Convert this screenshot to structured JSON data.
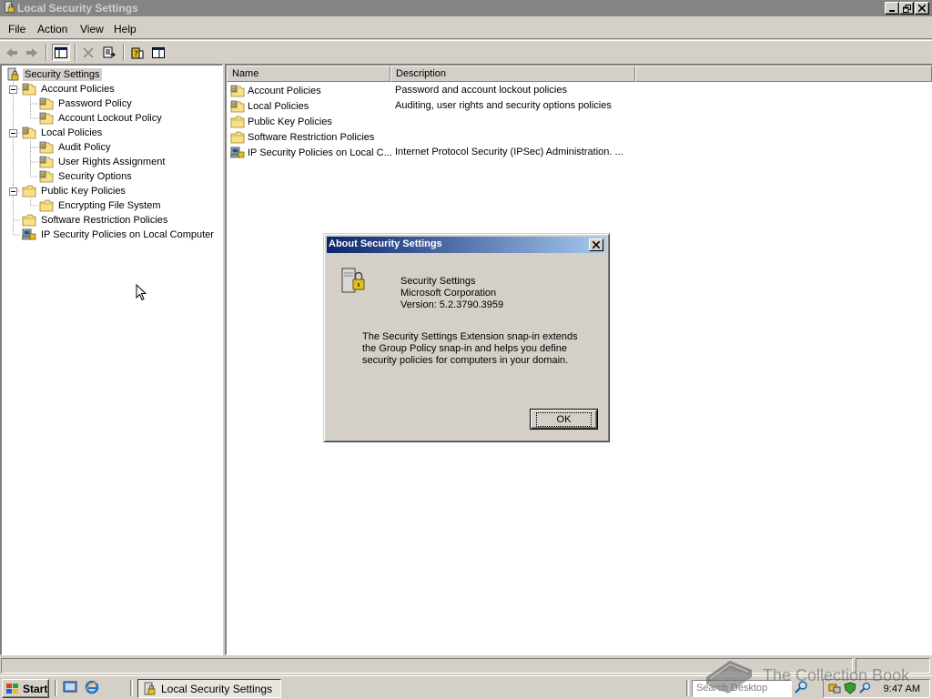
{
  "window": {
    "title": "Local Security Settings"
  },
  "menu": {
    "file": "File",
    "action": "Action",
    "view": "View",
    "help": "Help"
  },
  "tree": {
    "root": "Security Settings",
    "account_policies": "Account Policies",
    "password_policy": "Password Policy",
    "account_lockout_policy": "Account Lockout Policy",
    "local_policies": "Local Policies",
    "audit_policy": "Audit Policy",
    "user_rights_assignment": "User Rights Assignment",
    "security_options": "Security Options",
    "public_key_policies": "Public Key Policies",
    "encrypting_file_system": "Encrypting File System",
    "software_restriction_policies": "Software Restriction Policies",
    "ip_security_policies": "IP Security Policies on Local Computer"
  },
  "list": {
    "columns": {
      "name": "Name",
      "description": "Description"
    },
    "rows": [
      {
        "name": "Account Policies",
        "description": "Password and account lockout policies"
      },
      {
        "name": "Local Policies",
        "description": "Auditing, user rights and security options policies"
      },
      {
        "name": "Public Key Policies",
        "description": ""
      },
      {
        "name": "Software Restriction Policies",
        "description": ""
      },
      {
        "name": "IP Security Policies on Local C...",
        "description": "Internet Protocol Security (IPSec) Administration. ..."
      }
    ]
  },
  "dialog": {
    "title": "About Security Settings",
    "product": "Security Settings",
    "company": "Microsoft Corporation",
    "version": "Version: 5.2.3790.3959",
    "description_line1": "The Security Settings Extension snap-in extends",
    "description_line2": "the Group Policy snap-in and helps you define",
    "description_line3": "security policies for computers in your domain.",
    "ok_label": "OK"
  },
  "taskbar": {
    "start_label": "Start",
    "task_label": "Local Security Settings",
    "search_placeholder": "Search Desktop",
    "clock": "9:47 AM"
  },
  "watermark": {
    "text": "The Collection Book"
  },
  "colors": {
    "inactive_titlebar": "#848484",
    "dialog_title_start": "#0a246a",
    "dialog_title_end": "#a6caf0",
    "face": "#d4d0c8"
  }
}
